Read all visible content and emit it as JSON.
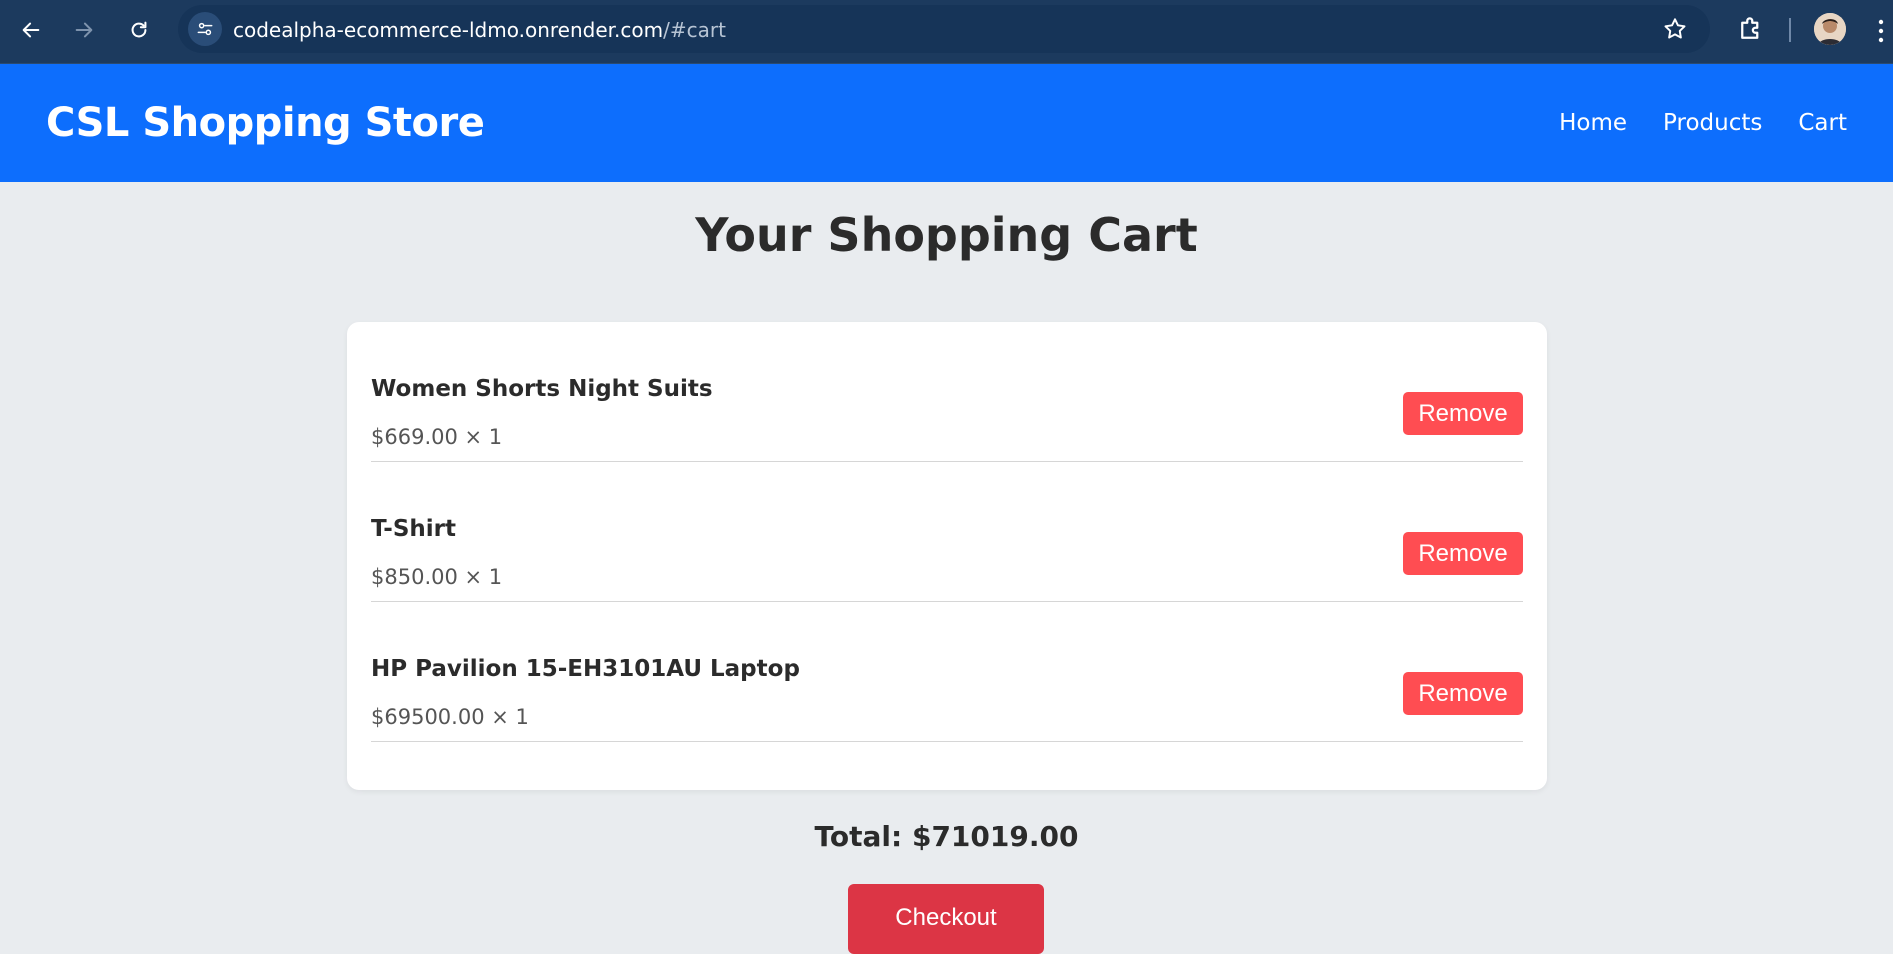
{
  "browser": {
    "url_host": "codealpha-ecommerce-ldmo.onrender.com",
    "url_path": "/#cart"
  },
  "header": {
    "brand": "CSL Shopping Store",
    "nav": [
      "Home",
      "Products",
      "Cart"
    ]
  },
  "main": {
    "title": "Your Shopping Cart",
    "items": [
      {
        "name": "Women Shorts Night Suits",
        "price": "$669.00 × 1",
        "remove_label": "Remove"
      },
      {
        "name": "T-Shirt",
        "price": "$850.00 × 1",
        "remove_label": "Remove"
      },
      {
        "name": "HP Pavilion 15-EH3101AU Laptop",
        "price": "$69500.00 × 1",
        "remove_label": "Remove"
      }
    ],
    "total": "Total: $71019.00",
    "checkout_label": "Checkout"
  },
  "colors": {
    "header_bg": "#0d6efd",
    "remove_button": "#ff4d52",
    "checkout_button": "#dc3545",
    "page_bg": "#e9ecef"
  },
  "icons": [
    "back-arrow-icon",
    "forward-arrow-icon",
    "reload-icon",
    "site-info-icon",
    "star-icon",
    "extensions-icon",
    "profile-avatar",
    "menu-dots-icon"
  ]
}
